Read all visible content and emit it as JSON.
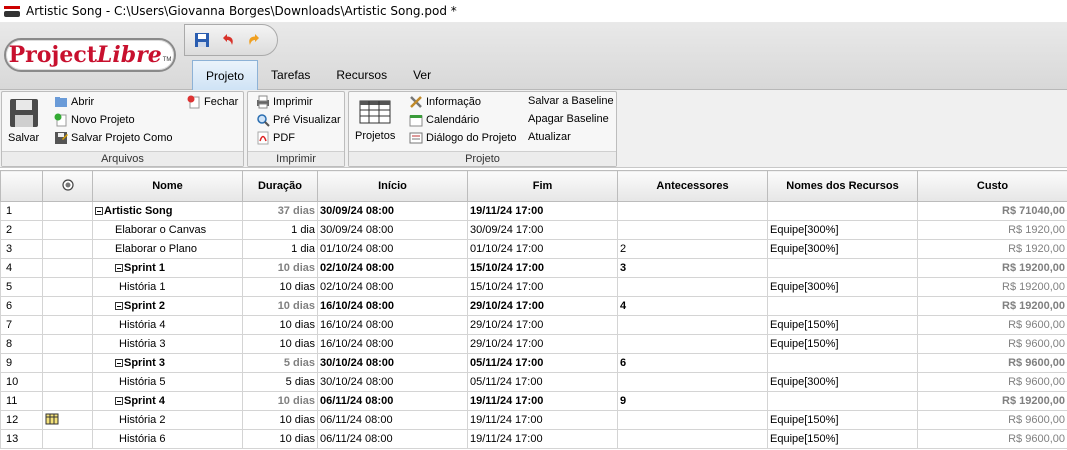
{
  "window": {
    "title": "Artistic Song - C:\\Users\\Giovanna Borges\\Downloads\\Artistic Song.pod *"
  },
  "logo": {
    "part1": "Project",
    "part2": "Libre",
    "tm": "TM"
  },
  "tabs": [
    {
      "label": "Projeto",
      "active": true
    },
    {
      "label": "Tarefas",
      "active": false
    },
    {
      "label": "Recursos",
      "active": false
    },
    {
      "label": "Ver",
      "active": false
    }
  ],
  "ribbon": {
    "arquivos": {
      "caption": "Arquivos",
      "salvar": "Salvar",
      "abrir": "Abrir",
      "fechar": "Fechar",
      "novo": "Novo Projeto",
      "salvar_como": "Salvar Projeto Como"
    },
    "imprimir": {
      "caption": "Imprimir",
      "imprimir": "Imprimir",
      "pre": "Pré Visualizar",
      "pdf": "PDF"
    },
    "projeto": {
      "caption": "Projeto",
      "projetos": "Projetos",
      "informacao": "Informação",
      "calendario": "Calendário",
      "dialogo": "Diálogo do Projeto",
      "salvar_baseline": "Salvar a Baseline",
      "apagar_baseline": "Apagar Baseline",
      "atualizar": "Atualizar"
    }
  },
  "table": {
    "headers": [
      "",
      "",
      "Nome",
      "Duração",
      "Início",
      "Fim",
      "Antecessores",
      "Nomes dos Recursos",
      "Custo"
    ],
    "rows": [
      {
        "num": "1",
        "summary": true,
        "indent": 0,
        "name": "Artistic Song",
        "dur": "37 dias",
        "start": "30/09/24 08:00",
        "finish": "19/11/24 17:00",
        "pred": "",
        "res": "",
        "cost": "R$ 71040,00",
        "icon": false
      },
      {
        "num": "2",
        "summary": false,
        "indent": 1,
        "name": "Elaborar o Canvas",
        "dur": "1 dia",
        "start": "30/09/24 08:00",
        "finish": "30/09/24 17:00",
        "pred": "",
        "res": "Equipe[300%]",
        "cost": "R$ 1920,00",
        "icon": false
      },
      {
        "num": "3",
        "summary": false,
        "indent": 1,
        "name": "Elaborar o Plano",
        "dur": "1 dia",
        "start": "01/10/24 08:00",
        "finish": "01/10/24 17:00",
        "pred": "2",
        "res": "Equipe[300%]",
        "cost": "R$ 1920,00",
        "icon": false
      },
      {
        "num": "4",
        "summary": true,
        "indent": 1,
        "name": "Sprint 1",
        "dur": "10 dias",
        "start": "02/10/24 08:00",
        "finish": "15/10/24 17:00",
        "pred": "3",
        "res": "",
        "cost": "R$ 19200,00",
        "icon": false
      },
      {
        "num": "5",
        "summary": false,
        "indent": 2,
        "name": "História 1",
        "dur": "10 dias",
        "start": "02/10/24 08:00",
        "finish": "15/10/24 17:00",
        "pred": "",
        "res": "Equipe[300%]",
        "cost": "R$ 19200,00",
        "icon": false
      },
      {
        "num": "6",
        "summary": true,
        "indent": 1,
        "name": "Sprint 2",
        "dur": "10 dias",
        "start": "16/10/24 08:00",
        "finish": "29/10/24 17:00",
        "pred": "4",
        "res": "",
        "cost": "R$ 19200,00",
        "icon": false
      },
      {
        "num": "7",
        "summary": false,
        "indent": 2,
        "name": "História 4",
        "dur": "10 dias",
        "start": "16/10/24 08:00",
        "finish": "29/10/24 17:00",
        "pred": "",
        "res": "Equipe[150%]",
        "cost": "R$ 9600,00",
        "icon": false
      },
      {
        "num": "8",
        "summary": false,
        "indent": 2,
        "name": "História 3",
        "dur": "10 dias",
        "start": "16/10/24 08:00",
        "finish": "29/10/24 17:00",
        "pred": "",
        "res": "Equipe[150%]",
        "cost": "R$ 9600,00",
        "icon": false
      },
      {
        "num": "9",
        "summary": true,
        "indent": 1,
        "name": "Sprint 3",
        "dur": "5 dias",
        "start": "30/10/24 08:00",
        "finish": "05/11/24 17:00",
        "pred": "6",
        "res": "",
        "cost": "R$ 9600,00",
        "icon": false
      },
      {
        "num": "10",
        "summary": false,
        "indent": 2,
        "name": "História 5",
        "dur": "5 dias",
        "start": "30/10/24 08:00",
        "finish": "05/11/24 17:00",
        "pred": "",
        "res": "Equipe[300%]",
        "cost": "R$ 9600,00",
        "icon": false
      },
      {
        "num": "11",
        "summary": true,
        "indent": 1,
        "name": "Sprint 4",
        "dur": "10 dias",
        "start": "06/11/24 08:00",
        "finish": "19/11/24 17:00",
        "pred": "9",
        "res": "",
        "cost": "R$ 19200,00",
        "icon": false
      },
      {
        "num": "12",
        "summary": false,
        "indent": 2,
        "name": "História 2",
        "dur": "10 dias",
        "start": "06/11/24 08:00",
        "finish": "19/11/24 17:00",
        "pred": "",
        "res": "Equipe[150%]",
        "cost": "R$ 9600,00",
        "icon": true
      },
      {
        "num": "13",
        "summary": false,
        "indent": 2,
        "name": "História 6",
        "dur": "10 dias",
        "start": "06/11/24 08:00",
        "finish": "19/11/24 17:00",
        "pred": "",
        "res": "Equipe[150%]",
        "cost": "R$ 9600,00",
        "icon": false
      }
    ]
  }
}
